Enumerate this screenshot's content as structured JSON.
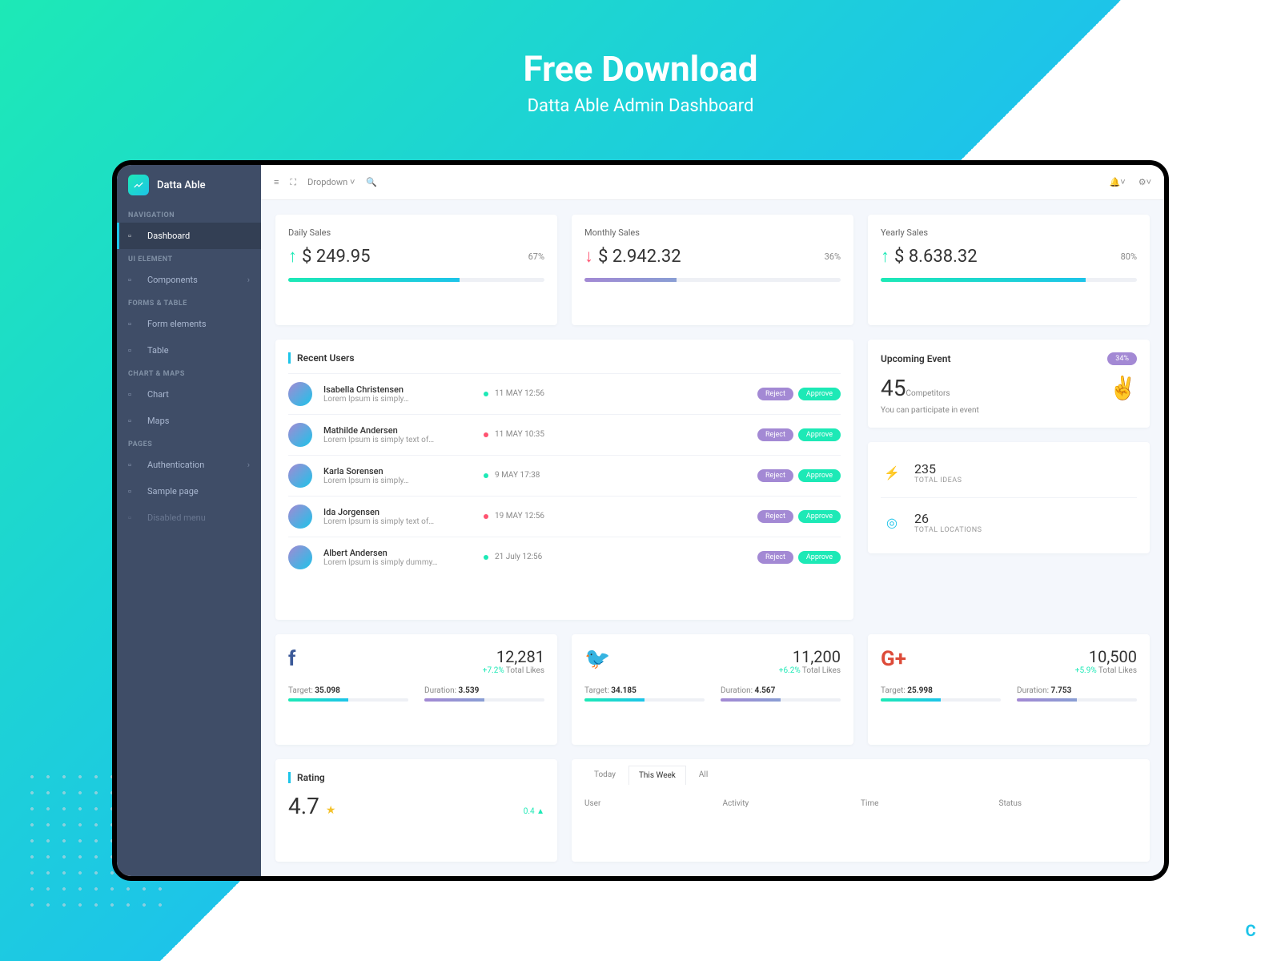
{
  "promo": {
    "title": "Free Download",
    "subtitle": "Datta Able Admin Dashboard"
  },
  "brand": "Datta Able",
  "topbar": {
    "dropdown": "Dropdown"
  },
  "nav": {
    "sections": [
      {
        "label": "NAVIGATION",
        "items": [
          {
            "label": "Dashboard",
            "active": true
          }
        ]
      },
      {
        "label": "UI ELEMENT",
        "items": [
          {
            "label": "Components",
            "chev": true
          }
        ]
      },
      {
        "label": "FORMS & TABLE",
        "items": [
          {
            "label": "Form elements"
          },
          {
            "label": "Table"
          }
        ]
      },
      {
        "label": "CHART & MAPS",
        "items": [
          {
            "label": "Chart"
          },
          {
            "label": "Maps"
          }
        ]
      },
      {
        "label": "PAGES",
        "items": [
          {
            "label": "Authentication",
            "chev": true
          },
          {
            "label": "Sample page"
          },
          {
            "label": "Disabled menu",
            "disabled": true
          }
        ]
      }
    ]
  },
  "sales": [
    {
      "label": "Daily Sales",
      "dir": "up",
      "amount": "$ 249.95",
      "pct": "67%",
      "bar": 67,
      "cls": "teal"
    },
    {
      "label": "Monthly Sales",
      "dir": "down",
      "amount": "$ 2.942.32",
      "pct": "36%",
      "bar": 36,
      "cls": "purple"
    },
    {
      "label": "Yearly Sales",
      "dir": "up",
      "amount": "$ 8.638.32",
      "pct": "80%",
      "bar": 80,
      "cls": "teal"
    }
  ],
  "recent": {
    "title": "Recent Users",
    "reject": "Reject",
    "approve": "Approve",
    "rows": [
      {
        "name": "Isabella Christensen",
        "sub": "Lorem Ipsum is simply…",
        "date": "11 MAY 12:56",
        "dot": "g"
      },
      {
        "name": "Mathilde Andersen",
        "sub": "Lorem Ipsum is simply text of…",
        "date": "11 MAY 10:35",
        "dot": "r"
      },
      {
        "name": "Karla Sorensen",
        "sub": "Lorem Ipsum is simply…",
        "date": "9 MAY 17:38",
        "dot": "g"
      },
      {
        "name": "Ida Jorgensen",
        "sub": "Lorem Ipsum is simply text of…",
        "date": "19 MAY 12:56",
        "dot": "r"
      },
      {
        "name": "Albert Andersen",
        "sub": "Lorem Ipsum is simply dummy…",
        "date": "21 July 12:56",
        "dot": "g"
      }
    ]
  },
  "event": {
    "title": "Upcoming Event",
    "badge": "34%",
    "num": "45",
    "label": "Competitors",
    "sub": "You can participate in event"
  },
  "stats": [
    {
      "num": "235",
      "label": "TOTAL IDEAS",
      "cls": "teal-i",
      "glyph": "⚡"
    },
    {
      "num": "26",
      "label": "TOTAL LOCATIONS",
      "cls": "blue-i",
      "glyph": "◎"
    }
  ],
  "social": [
    {
      "net": "facebook",
      "glyph": "f",
      "cls": "fb",
      "count": "12,281",
      "delta": "+7.2%",
      "sub": "Total Likes",
      "target": "35.098",
      "duration": "3.539"
    },
    {
      "net": "twitter",
      "glyph": "🐦",
      "cls": "tw",
      "count": "11,200",
      "delta": "+6.2%",
      "sub": "Total Likes",
      "target": "34.185",
      "duration": "4.567"
    },
    {
      "net": "google-plus",
      "glyph": "G+",
      "cls": "gp",
      "count": "10,500",
      "delta": "+5.9%",
      "sub": "Total Likes",
      "target": "25.998",
      "duration": "7.753"
    }
  ],
  "social_labels": {
    "target": "Target:",
    "duration": "Duration:"
  },
  "rating": {
    "title": "Rating",
    "value": "4.7",
    "delta": "0.4 ▲"
  },
  "activity": {
    "tabs": [
      "Today",
      "This Week",
      "All"
    ],
    "active": 1,
    "cols": [
      "User",
      "Activity",
      "Time",
      "Status"
    ]
  }
}
